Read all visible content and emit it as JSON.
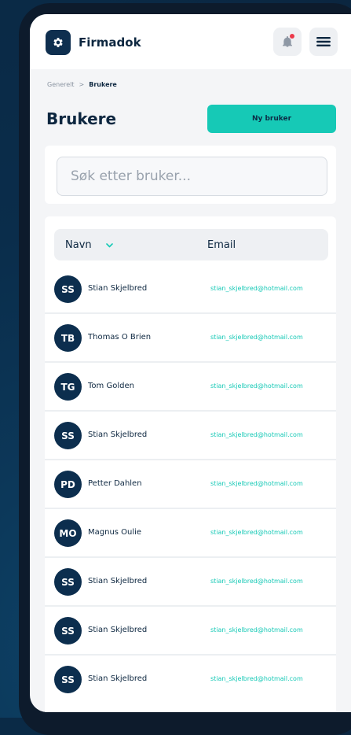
{
  "app": {
    "brand": "Firmadok"
  },
  "colors": {
    "navy": "#0f2f4f",
    "accent": "#16c9b6",
    "notification": "#ec3a4b"
  },
  "header": {
    "logo_icon": "gear-icon",
    "notification_icon": "bell-icon",
    "menu_icon": "hamburger-menu-icon"
  },
  "breadcrumb": {
    "parent": "Generelt",
    "separator": ">",
    "current": "Brukere"
  },
  "page": {
    "title": "Brukere",
    "new_user_label": "Ny bruker"
  },
  "search": {
    "placeholder": "Søk etter bruker...",
    "value": ""
  },
  "table": {
    "columns": {
      "name": "Navn",
      "email": "Email"
    },
    "sort_icon": "chevron-down-icon",
    "rows": [
      {
        "initials": "SS",
        "name": "Stian Skjelbred",
        "email": "stian_skjelbred@hotmail.com"
      },
      {
        "initials": "TB",
        "name": "Thomas O Brien",
        "email": "stian_skjelbred@hotmail.com"
      },
      {
        "initials": "TG",
        "name": "Tom Golden",
        "email": "stian_skjelbred@hotmail.com"
      },
      {
        "initials": "SS",
        "name": "Stian Skjelbred",
        "email": "stian_skjelbred@hotmail.com"
      },
      {
        "initials": "PD",
        "name": "Petter Dahlen",
        "email": "stian_skjelbred@hotmail.com"
      },
      {
        "initials": "MO",
        "name": "Magnus Oulie",
        "email": "stian_skjelbred@hotmail.com"
      },
      {
        "initials": "SS",
        "name": "Stian Skjelbred",
        "email": "stian_skjelbred@hotmail.com"
      },
      {
        "initials": "SS",
        "name": "Stian Skjelbred",
        "email": "stian_skjelbred@hotmail.com"
      },
      {
        "initials": "SS",
        "name": "Stian Skjelbred",
        "email": "stian_skjelbred@hotmail.com"
      }
    ]
  }
}
